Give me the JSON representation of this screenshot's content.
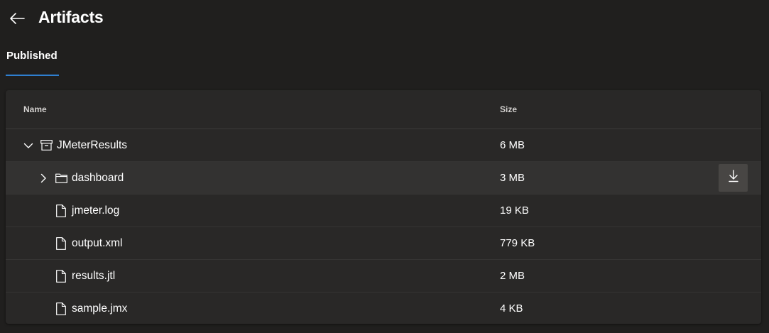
{
  "header": {
    "title": "Artifacts"
  },
  "tabs": [
    {
      "label": "Published",
      "active": true
    }
  ],
  "table": {
    "columns": {
      "name": "Name",
      "size": "Size"
    },
    "rows": [
      {
        "name": "JMeterResults",
        "size": "6 MB",
        "icon": "artifact-icon",
        "expander": "chevron-down-icon"
      },
      {
        "name": "dashboard",
        "size": "3 MB",
        "icon": "folder-icon",
        "expander": "chevron-right-icon",
        "hovered": true
      },
      {
        "name": "jmeter.log",
        "size": "19 KB",
        "icon": "file-icon"
      },
      {
        "name": "output.xml",
        "size": "779 KB",
        "icon": "file-icon"
      },
      {
        "name": "results.jtl",
        "size": "2 MB",
        "icon": "file-icon"
      },
      {
        "name": "sample.jmx",
        "size": "4 KB",
        "icon": "file-icon"
      }
    ]
  },
  "colors": {
    "background": "#201f1e",
    "card": "#292827",
    "accent": "#2f7fd0",
    "row_hover": "#333231"
  }
}
